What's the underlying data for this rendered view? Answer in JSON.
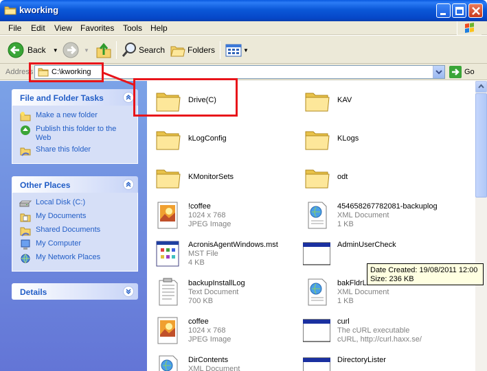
{
  "window": {
    "title": "kworking"
  },
  "menu": [
    "File",
    "Edit",
    "View",
    "Favorites",
    "Tools",
    "Help"
  ],
  "toolbar": {
    "back_label": "Back",
    "search_label": "Search",
    "folders_label": "Folders"
  },
  "address": {
    "label": "Address",
    "value": "C:\\kworking",
    "go_label": "Go"
  },
  "tasks": {
    "file_folder": {
      "title": "File and Folder Tasks",
      "items": [
        "Make a new folder",
        "Publish this folder to the Web",
        "Share this folder"
      ]
    },
    "other_places": {
      "title": "Other Places",
      "items": [
        "Local Disk (C:)",
        "My Documents",
        "Shared Documents",
        "My Computer",
        "My Network Places"
      ]
    },
    "details": {
      "title": "Details"
    }
  },
  "files": [
    {
      "name": "Drive(C)",
      "type": "folder"
    },
    {
      "name": "KAV",
      "type": "folder"
    },
    {
      "name": "kLogConfig",
      "type": "folder"
    },
    {
      "name": "KLogs",
      "type": "folder"
    },
    {
      "name": "KMonitorSets",
      "type": "folder"
    },
    {
      "name": "odt",
      "type": "folder"
    },
    {
      "name": "!coffee",
      "type": "jpeg",
      "line1": "1024 x 768",
      "line2": "JPEG Image"
    },
    {
      "name": "454658267782081-backuplog",
      "type": "xml",
      "line1": "XML Document",
      "line2": "1 KB"
    },
    {
      "name": "AcronisAgentWindows.mst",
      "type": "mst",
      "line1": "MST File",
      "line2": "4 KB"
    },
    {
      "name": "AdminUserCheck",
      "type": "exe",
      "line1": "",
      "line2": ""
    },
    {
      "name": "backupInstallLog",
      "type": "text",
      "line1": "Text Document",
      "line2": "700 KB"
    },
    {
      "name": "bakFldrLi",
      "type": "xml",
      "line1": "XML Document",
      "line2": "1 KB"
    },
    {
      "name": "coffee",
      "type": "jpeg",
      "line1": "1024 x 768",
      "line2": "JPEG Image"
    },
    {
      "name": "curl",
      "type": "exe",
      "line1": "The cURL executable",
      "line2": "cURL, http://curl.haxx.se/"
    },
    {
      "name": "DirContents",
      "type": "xml",
      "line1": "XML Document",
      "line2": ""
    },
    {
      "name": "DirectoryLister",
      "type": "exe",
      "line1": "",
      "line2": ""
    }
  ],
  "tooltip": {
    "line1": "Date Created: 19/08/2011 12:00",
    "line2": "Size: 236 KB"
  },
  "colors": {
    "annotation": "#e8141a",
    "link": "#215dc6",
    "titlebar": "#0b58d8"
  }
}
